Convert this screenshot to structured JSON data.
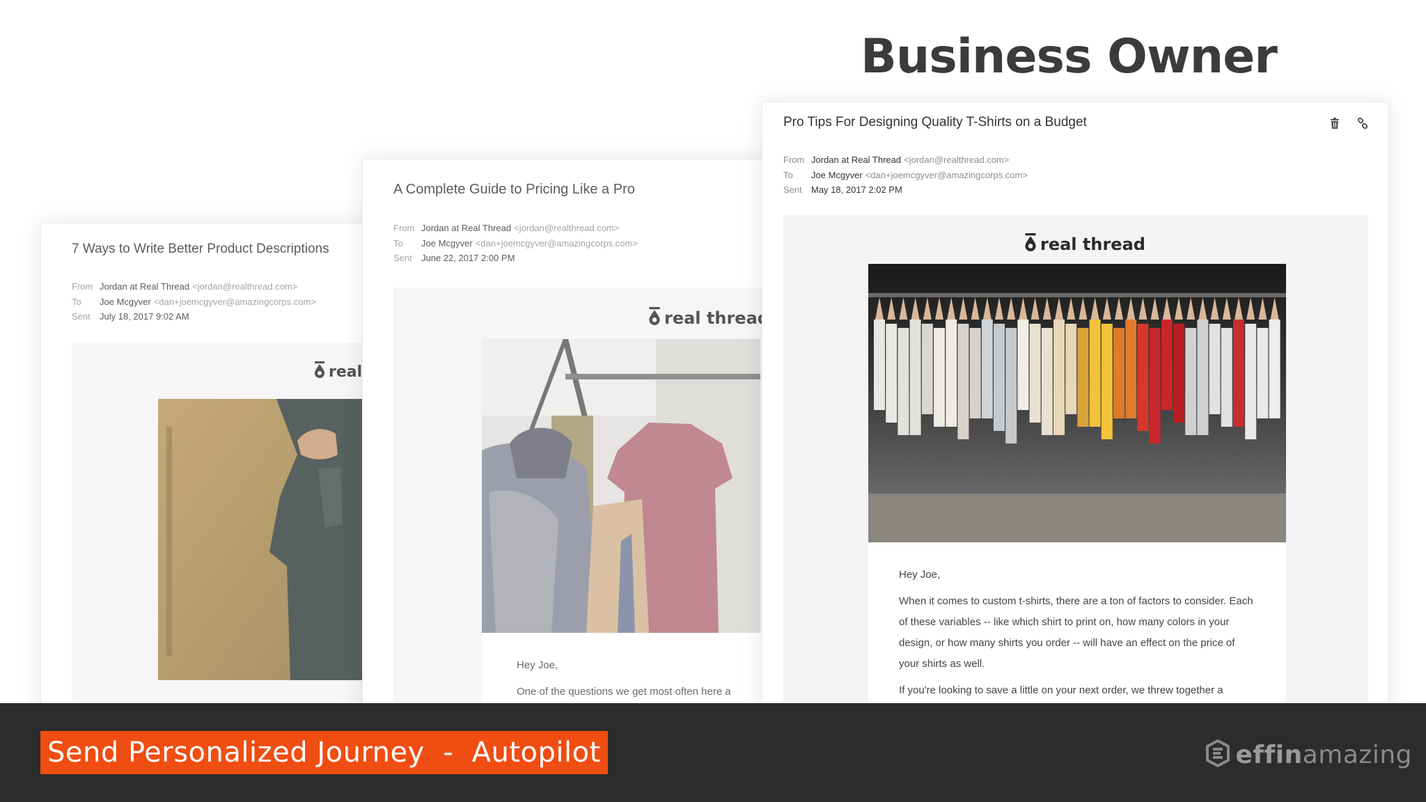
{
  "headline": "Business Owner",
  "labels": {
    "from": "From",
    "to": "To",
    "sent": "Sent"
  },
  "brand_name": "real thread",
  "cards": [
    {
      "subject": "7 Ways to Write Better Product Descriptions",
      "from_name": "Jordan at Real Thread",
      "from_email": "<jordan@realthread.com>",
      "to_name": "Joe Mcgyver",
      "to_email": "<dan+joemcgyver@amazingcorps.com>",
      "sent": "July 18, 2017 9:02 AM"
    },
    {
      "subject": "A Complete Guide to Pricing Like a Pro",
      "from_name": "Jordan at Real Thread",
      "from_email": "<jordan@realthread.com>",
      "to_name": "Joe Mcgyver",
      "to_email": "<dan+joemcgyver@amazingcorps.com>",
      "sent": "June 22, 2017 2:00 PM",
      "greeting": "Hey Joe,",
      "snippet": "One of the questions we get most often here a"
    },
    {
      "subject": "Pro Tips For Designing Quality T-Shirts on a Budget",
      "from_name": "Jordan at Real Thread",
      "from_email": "<jordan@realthread.com>",
      "to_name": "Joe Mcgyver",
      "to_email": "<dan+joemcgyver@amazingcorps.com>",
      "sent": "May 18, 2017 2:02 PM",
      "greeting": "Hey Joe,",
      "para1": "When it comes to custom t-shirts, there are a ton of factors to consider. Each of these variables -- like which shirt to print on, how many colors in your design, or how many shirts you order -- will have an effect on the price of your shirts as well.",
      "para2": "If you're looking to save a little on your next order, we threw together a"
    }
  ],
  "banner": "Send Personalized Journey  -  Autopilot",
  "logo": {
    "part1": "effin",
    "part2": "amazing"
  },
  "icons": {
    "delete": "trash-icon",
    "link": "link-icon"
  },
  "colors": {
    "banner": "#f04d12",
    "bar": "#2c2c2c",
    "headline": "#3b3b3b"
  }
}
